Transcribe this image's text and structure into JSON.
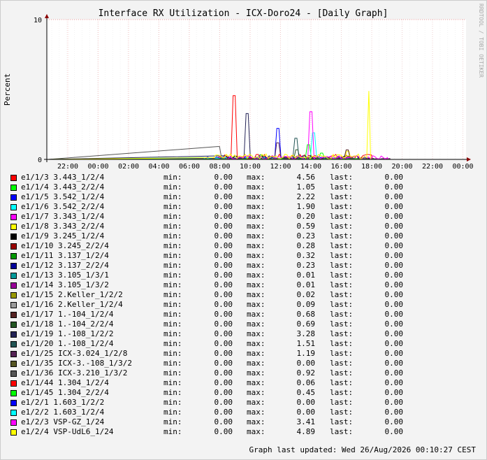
{
  "chart_data": {
    "type": "line",
    "title": "Interface RX Utilization - ICX-Doro24 - [Daily Graph]",
    "ylabel": "Percent",
    "ylim": [
      0,
      10
    ],
    "y_ticks": [
      "0",
      "10"
    ],
    "x_ticks": [
      "22:00",
      "00:00",
      "02:00",
      "04:00",
      "06:00",
      "08:00",
      "10:00",
      "12:00",
      "14:00",
      "16:00",
      "18:00",
      "20:00",
      "22:00",
      "00:00"
    ],
    "watermark": "RRDTOOL / TOBI OETIKER",
    "legend_labels": {
      "min": "min:",
      "max": "max:",
      "last": "last:"
    },
    "series": [
      {
        "name": "e1/1/3 3.443_1/2/4",
        "color": "#ff0000",
        "min": "0.00",
        "max": "4.56",
        "last": "0.00"
      },
      {
        "name": "e1/1/4 3.443_2/2/4",
        "color": "#00ff00",
        "min": "0.00",
        "max": "1.05",
        "last": "0.00"
      },
      {
        "name": "e1/1/5 3.542_1/2/4",
        "color": "#0000ff",
        "min": "0.00",
        "max": "2.22",
        "last": "0.00"
      },
      {
        "name": "e1/1/6 3.542_2/2/4",
        "color": "#00ffff",
        "min": "0.00",
        "max": "1.90",
        "last": "0.00"
      },
      {
        "name": "e1/1/7 3.343_1/2/4",
        "color": "#ff00ff",
        "min": "0.00",
        "max": "0.20",
        "last": "0.00"
      },
      {
        "name": "e1/1/8 3.343_2/2/4",
        "color": "#ffff00",
        "min": "0.00",
        "max": "0.59",
        "last": "0.00"
      },
      {
        "name": "e1/1/9 3.245_1/2/4",
        "color": "#000000",
        "min": "0.00",
        "max": "0.23",
        "last": "0.00"
      },
      {
        "name": "e1/1/10 3.245_2/2/4",
        "color": "#990000",
        "min": "0.00",
        "max": "0.28",
        "last": "0.00"
      },
      {
        "name": "e1/1/11 3.137_1/2/4",
        "color": "#009900",
        "min": "0.00",
        "max": "0.32",
        "last": "0.00"
      },
      {
        "name": "e1/1/12 3.137_2/2/4",
        "color": "#000099",
        "min": "0.00",
        "max": "0.23",
        "last": "0.00"
      },
      {
        "name": "e1/1/13 3.105_1/3/1",
        "color": "#009999",
        "min": "0.00",
        "max": "0.01",
        "last": "0.00"
      },
      {
        "name": "e1/1/14 3.105_1/3/2",
        "color": "#990099",
        "min": "0.00",
        "max": "0.01",
        "last": "0.00"
      },
      {
        "name": "e1/1/15 2.Keller_1/2/2",
        "color": "#999900",
        "min": "0.00",
        "max": "0.02",
        "last": "0.00"
      },
      {
        "name": "e1/1/16 2.Keller_1/2/4",
        "color": "#999999",
        "min": "0.00",
        "max": "0.09",
        "last": "0.00"
      },
      {
        "name": "e1/1/17 1.-104_1/2/4",
        "color": "#552222",
        "min": "0.00",
        "max": "0.68",
        "last": "0.00"
      },
      {
        "name": "e1/1/18 1.-104_2/2/4",
        "color": "#225522",
        "min": "0.00",
        "max": "0.69",
        "last": "0.00"
      },
      {
        "name": "e1/1/19 1.-108_1/2/2",
        "color": "#222255",
        "min": "0.00",
        "max": "3.28",
        "last": "0.00"
      },
      {
        "name": "e1/1/20 1.-108_1/2/4",
        "color": "#225555",
        "min": "0.00",
        "max": "1.51",
        "last": "0.00"
      },
      {
        "name": "e1/1/25 ICX-3.024_1/2/8",
        "color": "#552255",
        "min": "0.00",
        "max": "1.19",
        "last": "0.00"
      },
      {
        "name": "e1/1/35 ICX-3.-108_1/3/2",
        "color": "#555522",
        "min": "0.00",
        "max": "0.00",
        "last": "0.00"
      },
      {
        "name": "e1/1/36 ICX-3.210_1/3/2",
        "color": "#555555",
        "min": "0.00",
        "max": "0.92",
        "last": "0.00"
      },
      {
        "name": "e1/1/44 1.304_1/2/4",
        "color": "#ff0000",
        "min": "0.00",
        "max": "0.06",
        "last": "0.00"
      },
      {
        "name": "e1/1/45 1.304_2/2/4",
        "color": "#00ff00",
        "min": "0.00",
        "max": "0.45",
        "last": "0.00"
      },
      {
        "name": "e1/2/1 1.603_1/2/2",
        "color": "#0000ff",
        "min": "0.00",
        "max": "0.00",
        "last": "0.00"
      },
      {
        "name": "e1/2/2 1.603_1/2/4",
        "color": "#00ffff",
        "min": "0.00",
        "max": "0.00",
        "last": "0.00"
      },
      {
        "name": "e1/2/3 VSP-GZ_1/24",
        "color": "#ff00ff",
        "min": "0.00",
        "max": "3.41",
        "last": "0.00"
      },
      {
        "name": "e1/2/4 VSP-UdL6_1/24",
        "color": "#ffff00",
        "min": "0.00",
        "max": "4.89",
        "last": "0.00"
      }
    ]
  },
  "footer": "Graph last updated: Wed 26/Aug/2026 00:10:27 CEST"
}
